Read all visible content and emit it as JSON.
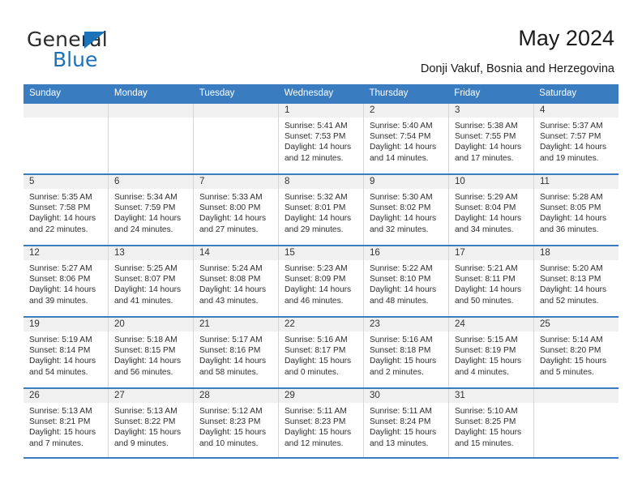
{
  "brand": {
    "name_part1": "General",
    "name_part2": "Blue",
    "accent_color": "#1b72b8"
  },
  "header": {
    "title": "May 2024",
    "subtitle": "Donji Vakuf, Bosnia and Herzegovina"
  },
  "calendar": {
    "header_color": "#3a7cc0",
    "weekdays": [
      "Sunday",
      "Monday",
      "Tuesday",
      "Wednesday",
      "Thursday",
      "Friday",
      "Saturday"
    ],
    "weeks": [
      [
        {
          "day": "",
          "lines": []
        },
        {
          "day": "",
          "lines": []
        },
        {
          "day": "",
          "lines": []
        },
        {
          "day": "1",
          "lines": [
            "Sunrise: 5:41 AM",
            "Sunset: 7:53 PM",
            "Daylight: 14 hours",
            "and 12 minutes."
          ]
        },
        {
          "day": "2",
          "lines": [
            "Sunrise: 5:40 AM",
            "Sunset: 7:54 PM",
            "Daylight: 14 hours",
            "and 14 minutes."
          ]
        },
        {
          "day": "3",
          "lines": [
            "Sunrise: 5:38 AM",
            "Sunset: 7:55 PM",
            "Daylight: 14 hours",
            "and 17 minutes."
          ]
        },
        {
          "day": "4",
          "lines": [
            "Sunrise: 5:37 AM",
            "Sunset: 7:57 PM",
            "Daylight: 14 hours",
            "and 19 minutes."
          ]
        }
      ],
      [
        {
          "day": "5",
          "lines": [
            "Sunrise: 5:35 AM",
            "Sunset: 7:58 PM",
            "Daylight: 14 hours",
            "and 22 minutes."
          ]
        },
        {
          "day": "6",
          "lines": [
            "Sunrise: 5:34 AM",
            "Sunset: 7:59 PM",
            "Daylight: 14 hours",
            "and 24 minutes."
          ]
        },
        {
          "day": "7",
          "lines": [
            "Sunrise: 5:33 AM",
            "Sunset: 8:00 PM",
            "Daylight: 14 hours",
            "and 27 minutes."
          ]
        },
        {
          "day": "8",
          "lines": [
            "Sunrise: 5:32 AM",
            "Sunset: 8:01 PM",
            "Daylight: 14 hours",
            "and 29 minutes."
          ]
        },
        {
          "day": "9",
          "lines": [
            "Sunrise: 5:30 AM",
            "Sunset: 8:02 PM",
            "Daylight: 14 hours",
            "and 32 minutes."
          ]
        },
        {
          "day": "10",
          "lines": [
            "Sunrise: 5:29 AM",
            "Sunset: 8:04 PM",
            "Daylight: 14 hours",
            "and 34 minutes."
          ]
        },
        {
          "day": "11",
          "lines": [
            "Sunrise: 5:28 AM",
            "Sunset: 8:05 PM",
            "Daylight: 14 hours",
            "and 36 minutes."
          ]
        }
      ],
      [
        {
          "day": "12",
          "lines": [
            "Sunrise: 5:27 AM",
            "Sunset: 8:06 PM",
            "Daylight: 14 hours",
            "and 39 minutes."
          ]
        },
        {
          "day": "13",
          "lines": [
            "Sunrise: 5:25 AM",
            "Sunset: 8:07 PM",
            "Daylight: 14 hours",
            "and 41 minutes."
          ]
        },
        {
          "day": "14",
          "lines": [
            "Sunrise: 5:24 AM",
            "Sunset: 8:08 PM",
            "Daylight: 14 hours",
            "and 43 minutes."
          ]
        },
        {
          "day": "15",
          "lines": [
            "Sunrise: 5:23 AM",
            "Sunset: 8:09 PM",
            "Daylight: 14 hours",
            "and 46 minutes."
          ]
        },
        {
          "day": "16",
          "lines": [
            "Sunrise: 5:22 AM",
            "Sunset: 8:10 PM",
            "Daylight: 14 hours",
            "and 48 minutes."
          ]
        },
        {
          "day": "17",
          "lines": [
            "Sunrise: 5:21 AM",
            "Sunset: 8:11 PM",
            "Daylight: 14 hours",
            "and 50 minutes."
          ]
        },
        {
          "day": "18",
          "lines": [
            "Sunrise: 5:20 AM",
            "Sunset: 8:13 PM",
            "Daylight: 14 hours",
            "and 52 minutes."
          ]
        }
      ],
      [
        {
          "day": "19",
          "lines": [
            "Sunrise: 5:19 AM",
            "Sunset: 8:14 PM",
            "Daylight: 14 hours",
            "and 54 minutes."
          ]
        },
        {
          "day": "20",
          "lines": [
            "Sunrise: 5:18 AM",
            "Sunset: 8:15 PM",
            "Daylight: 14 hours",
            "and 56 minutes."
          ]
        },
        {
          "day": "21",
          "lines": [
            "Sunrise: 5:17 AM",
            "Sunset: 8:16 PM",
            "Daylight: 14 hours",
            "and 58 minutes."
          ]
        },
        {
          "day": "22",
          "lines": [
            "Sunrise: 5:16 AM",
            "Sunset: 8:17 PM",
            "Daylight: 15 hours",
            "and 0 minutes."
          ]
        },
        {
          "day": "23",
          "lines": [
            "Sunrise: 5:16 AM",
            "Sunset: 8:18 PM",
            "Daylight: 15 hours",
            "and 2 minutes."
          ]
        },
        {
          "day": "24",
          "lines": [
            "Sunrise: 5:15 AM",
            "Sunset: 8:19 PM",
            "Daylight: 15 hours",
            "and 4 minutes."
          ]
        },
        {
          "day": "25",
          "lines": [
            "Sunrise: 5:14 AM",
            "Sunset: 8:20 PM",
            "Daylight: 15 hours",
            "and 5 minutes."
          ]
        }
      ],
      [
        {
          "day": "26",
          "lines": [
            "Sunrise: 5:13 AM",
            "Sunset: 8:21 PM",
            "Daylight: 15 hours",
            "and 7 minutes."
          ]
        },
        {
          "day": "27",
          "lines": [
            "Sunrise: 5:13 AM",
            "Sunset: 8:22 PM",
            "Daylight: 15 hours",
            "and 9 minutes."
          ]
        },
        {
          "day": "28",
          "lines": [
            "Sunrise: 5:12 AM",
            "Sunset: 8:23 PM",
            "Daylight: 15 hours",
            "and 10 minutes."
          ]
        },
        {
          "day": "29",
          "lines": [
            "Sunrise: 5:11 AM",
            "Sunset: 8:23 PM",
            "Daylight: 15 hours",
            "and 12 minutes."
          ]
        },
        {
          "day": "30",
          "lines": [
            "Sunrise: 5:11 AM",
            "Sunset: 8:24 PM",
            "Daylight: 15 hours",
            "and 13 minutes."
          ]
        },
        {
          "day": "31",
          "lines": [
            "Sunrise: 5:10 AM",
            "Sunset: 8:25 PM",
            "Daylight: 15 hours",
            "and 15 minutes."
          ]
        },
        {
          "day": "",
          "lines": []
        }
      ]
    ]
  }
}
